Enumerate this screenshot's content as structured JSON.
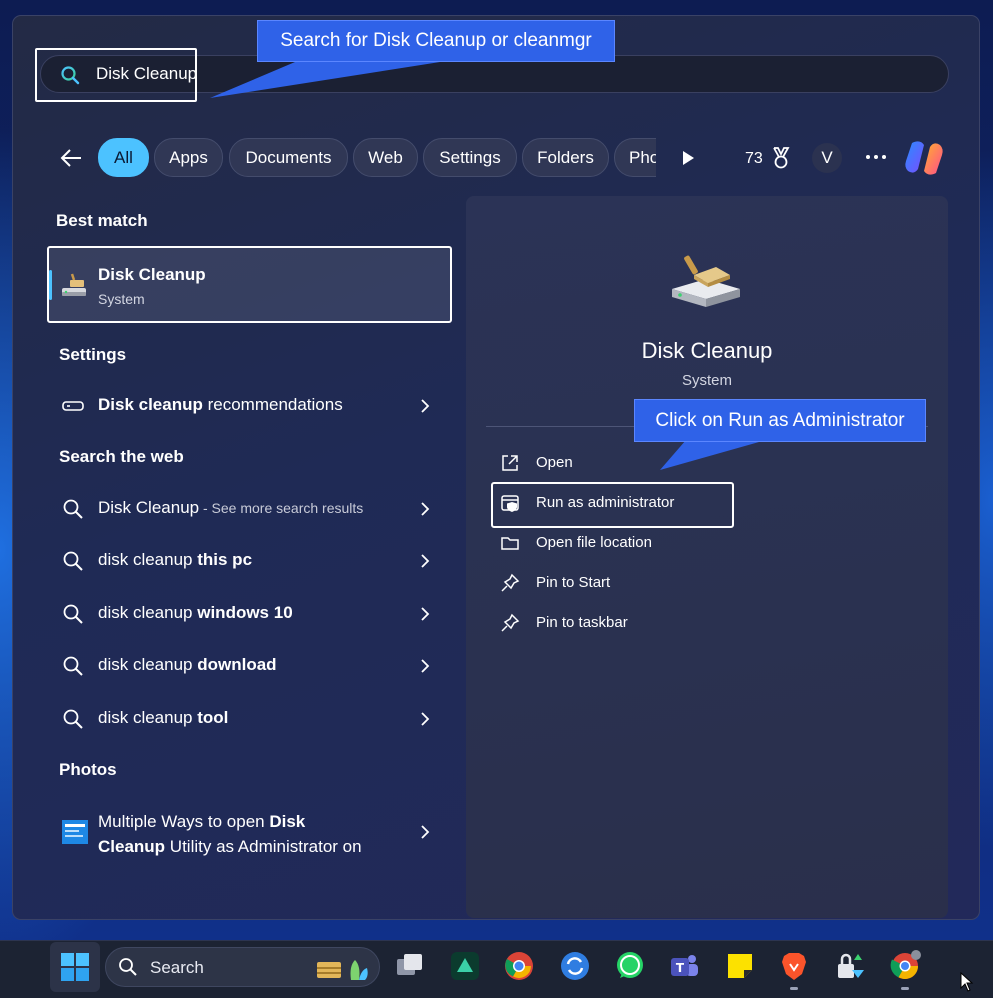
{
  "search": {
    "query": "Disk Cleanup",
    "callout": "Search for Disk Cleanup or cleanmgr"
  },
  "filters": {
    "items": [
      "All",
      "Apps",
      "Documents",
      "Web",
      "Settings",
      "Folders",
      "Pho"
    ],
    "active": "All",
    "points": "73",
    "avatar_initial": "V"
  },
  "best_match": {
    "heading": "Best match",
    "title": "Disk Cleanup",
    "subtitle": "System"
  },
  "settings_section": {
    "heading": "Settings",
    "item_bold": "Disk cleanup",
    "item_rest": " recommendations"
  },
  "web_section": {
    "heading": "Search the web",
    "items": [
      {
        "plain": "Disk Cleanup",
        "bold": "",
        "muted": " - See more search results"
      },
      {
        "plain": "disk cleanup ",
        "bold": "this pc",
        "muted": ""
      },
      {
        "plain": "disk cleanup ",
        "bold": "windows 10",
        "muted": ""
      },
      {
        "plain": "disk cleanup ",
        "bold": "download",
        "muted": ""
      },
      {
        "plain": "disk cleanup ",
        "bold": "tool",
        "muted": ""
      }
    ]
  },
  "photos_section": {
    "heading": "Photos",
    "line1_plain": "Multiple Ways to open ",
    "line1_bold": "Disk",
    "line2_bold": "Cleanup",
    "line2_plain": " Utility as Administrator on"
  },
  "preview": {
    "title": "Disk Cleanup",
    "subtitle": "System",
    "callout": "Click on Run as Administrator",
    "actions": [
      "Open",
      "Run as administrator",
      "Open file location",
      "Pin to Start",
      "Pin to taskbar"
    ]
  },
  "taskbar": {
    "search_label": "Search"
  },
  "colors": {
    "accent": "#4cc2ff",
    "callout": "#2f62e8"
  }
}
